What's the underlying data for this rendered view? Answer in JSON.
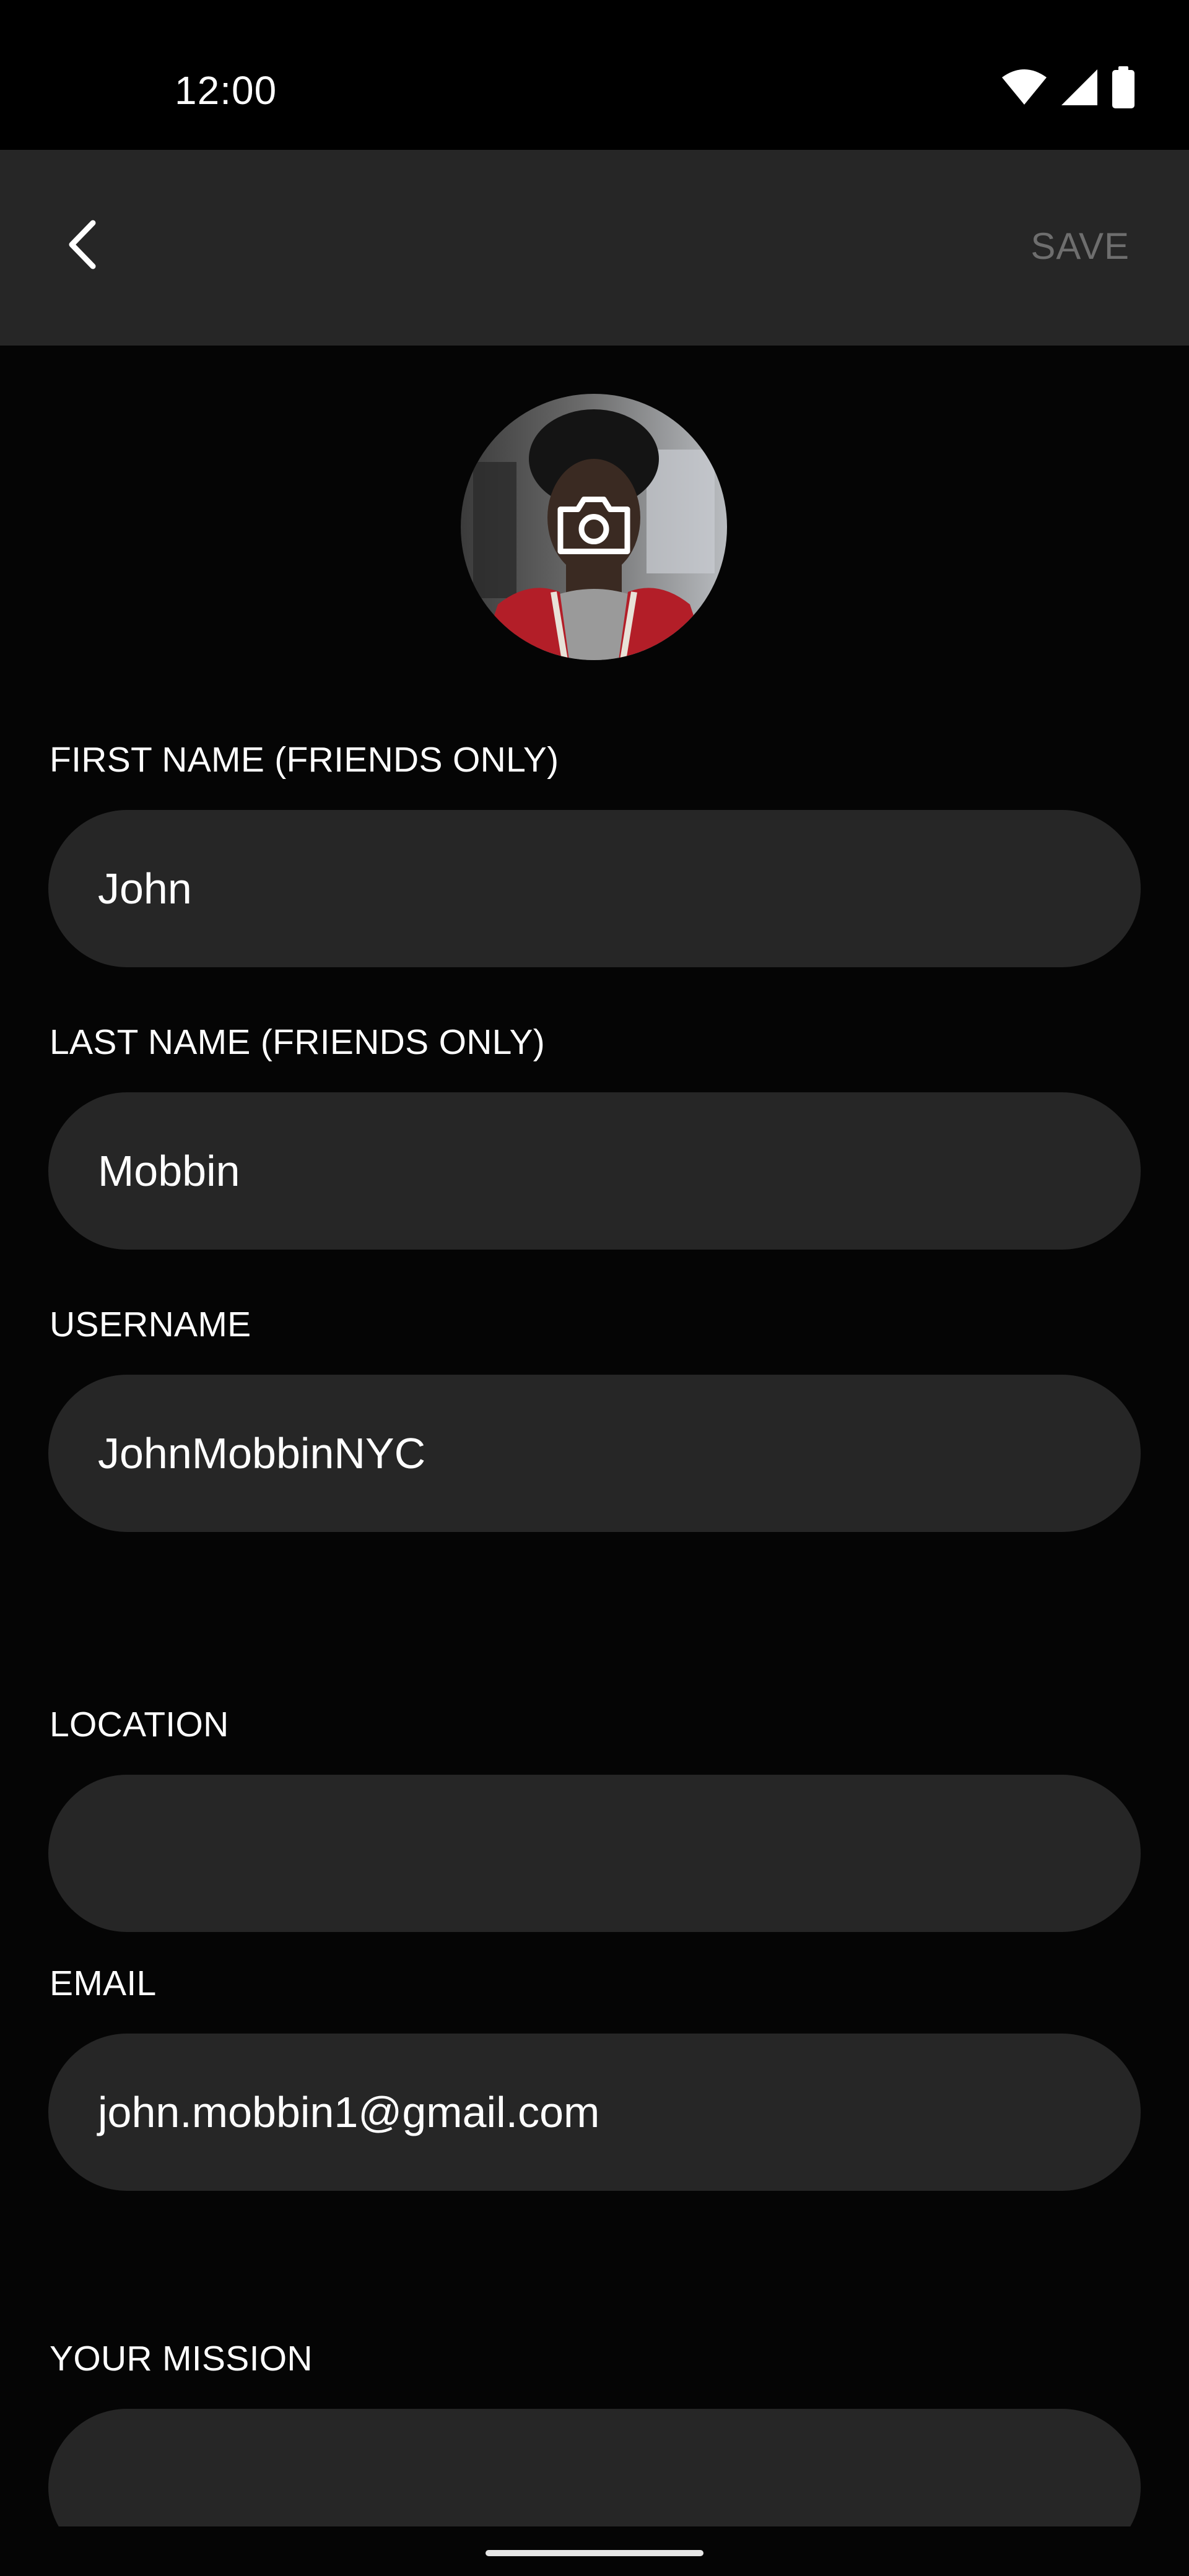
{
  "status_bar": {
    "time": "12:00",
    "icons": [
      "wifi-icon",
      "cellular-signal-icon",
      "battery-icon"
    ]
  },
  "app_bar": {
    "back_icon": "chevron-left-icon",
    "save_label": "SAVE"
  },
  "avatar": {
    "overlay_icon": "camera-icon"
  },
  "form": {
    "first_name": {
      "label": "FIRST NAME (FRIENDS ONLY)",
      "value": "John"
    },
    "last_name": {
      "label": "LAST NAME (FRIENDS ONLY)",
      "value": "Mobbin"
    },
    "username": {
      "label": "USERNAME",
      "value": "JohnMobbinNYC"
    },
    "location": {
      "label": "LOCATION",
      "value": ""
    },
    "email": {
      "label": "EMAIL",
      "value": "john.mobbin1@gmail.com"
    },
    "mission": {
      "label": "YOUR MISSION",
      "value": ""
    }
  },
  "colors": {
    "background": "#050505",
    "app_bar": "#262626",
    "input_fill": "#262626",
    "save_disabled": "#6e6e6e",
    "text": "#ffffff"
  }
}
